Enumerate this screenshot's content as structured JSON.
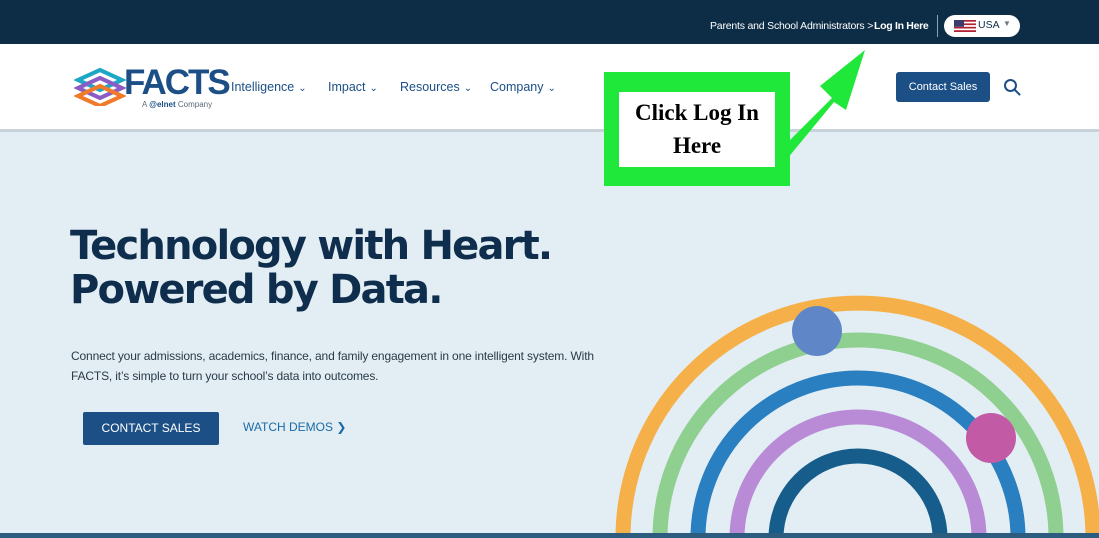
{
  "topbar": {
    "parents_link": "Parents and School Administrators >",
    "login_link": "Log In Here",
    "region": {
      "code": "USA",
      "flag_icon": "us-flag-icon",
      "caret_icon": "caret-down-icon"
    }
  },
  "brand": {
    "name": "FACTS",
    "tagline_prefix": "A",
    "tagline_company": "@elnet",
    "tagline_suffix": "Company"
  },
  "nav": {
    "items": [
      {
        "label": "Intelligence"
      },
      {
        "label": "Impact"
      },
      {
        "label": "Resources"
      },
      {
        "label": "Company"
      }
    ],
    "contact_label": "Contact Sales",
    "search_icon": "search-icon"
  },
  "hero": {
    "headline_line1": "Technology with Heart.",
    "headline_line2": "Powered by Data.",
    "lede": "Connect your admissions, academics, finance, and family engagement in one intelligent system. With FACTS, it’s simple to turn your school’s data into outcomes.",
    "cta_label": "CONTACT SALES",
    "demos_label": "WATCH DEMOS",
    "demos_icon": "chevron-right-icon"
  },
  "annotation": {
    "text_line1": "Click Log In",
    "text_line2": "Here",
    "color": "#20e83a"
  },
  "colors": {
    "topbar": "#0d2d47",
    "brand_blue": "#1b4f86",
    "hero_bg": "#e2eef3",
    "headline": "#0f2d4c"
  }
}
